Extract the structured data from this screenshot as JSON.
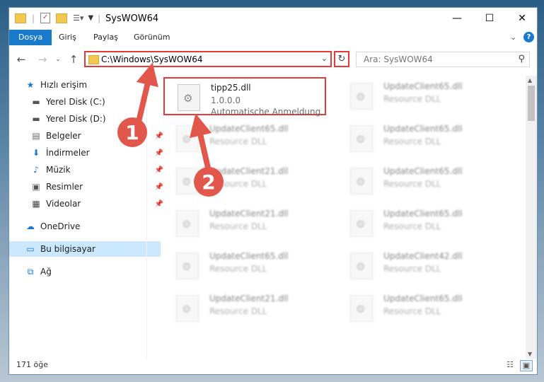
{
  "window": {
    "title": "SysWOW64",
    "controls": {
      "minimize": "—",
      "maximize": "☐",
      "close": "✕"
    }
  },
  "ribbon": {
    "tabs": [
      "Dosya",
      "Giriş",
      "Paylaş",
      "Görünüm"
    ]
  },
  "address": {
    "path": "C:\\Windows\\SysWOW64",
    "search_placeholder": "Ara: SysWOW64"
  },
  "nav": {
    "items": [
      {
        "label": "Hızlı erişim",
        "icon": "star-icon",
        "pinned": false
      },
      {
        "label": "Yerel Disk (C:)",
        "icon": "drive-icon",
        "pinned": false
      },
      {
        "label": "Yerel Disk (D:)",
        "icon": "drive-icon",
        "pinned": false
      },
      {
        "label": "Belgeler",
        "icon": "document-icon",
        "pinned": true
      },
      {
        "label": "İndirmeler",
        "icon": "download-icon",
        "pinned": true
      },
      {
        "label": "Müzik",
        "icon": "music-icon",
        "pinned": true
      },
      {
        "label": "Resimler",
        "icon": "picture-icon",
        "pinned": true
      },
      {
        "label": "Videolar",
        "icon": "video-icon",
        "pinned": true
      },
      {
        "label": "OneDrive",
        "icon": "cloud-icon",
        "pinned": false
      },
      {
        "label": "Bu bilgisayar",
        "icon": "computer-icon",
        "pinned": false
      },
      {
        "label": "Ağ",
        "icon": "network-icon",
        "pinned": false
      }
    ],
    "selected": "Bu bilgisayar"
  },
  "files": {
    "selected": {
      "name": "tipp25.dll",
      "version": "1.0.0.0",
      "description": "Automatische Anmeldung"
    },
    "left_column": [
      {
        "name": "UpdateClient65.dll",
        "type": "Resource DLL"
      },
      {
        "name": "UpdateClient21.dll",
        "type": "Resource DLL"
      },
      {
        "name": "UpdateClient21.dll",
        "type": "Resource DLL"
      },
      {
        "name": "UpdateClient65.dll",
        "type": "Resource DLL"
      },
      {
        "name": "UpdateClient21.dll",
        "type": "Resource DLL"
      }
    ],
    "right_column": [
      {
        "name": "UpdateClient65.dll",
        "type": "Resource DLL"
      },
      {
        "name": "UpdateClient65.dll",
        "type": "Resource DLL"
      },
      {
        "name": "UpdateClient65.dll",
        "type": "Resource DLL"
      },
      {
        "name": "UpdateClient65.dll",
        "type": "Resource DLL"
      },
      {
        "name": "UpdateClient42.dll",
        "type": "Resource DLL"
      },
      {
        "name": "UpdateClient65.dll",
        "type": "Resource DLL"
      }
    ]
  },
  "status": {
    "item_count": "171 öğe"
  },
  "annotations": {
    "step1": "1",
    "step2": "2",
    "arrow_color": "#e2574c"
  }
}
